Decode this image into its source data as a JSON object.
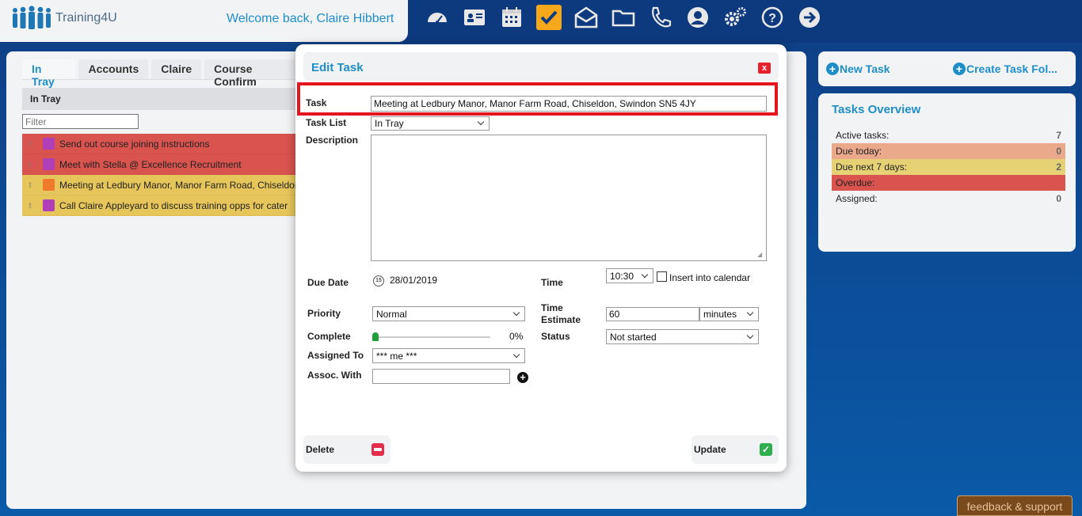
{
  "app": {
    "name": "Training4U",
    "welcome": "Welcome back, Claire Hibbert"
  },
  "nav": {
    "icons": [
      "dashboard-icon",
      "contacts-icon",
      "calendar-icon",
      "tasks-icon",
      "mail-icon",
      "folder-icon",
      "phone-icon",
      "user-icon",
      "settings-icon",
      "help-icon",
      "logout-icon"
    ],
    "active": "tasks-icon",
    "accent": "#f6a81b"
  },
  "tabs": [
    {
      "label": "In Tray"
    },
    {
      "label": "Accounts"
    },
    {
      "label": "Claire"
    },
    {
      "label": "Course Confirm"
    }
  ],
  "list": {
    "header": "In Tray",
    "filter_placeholder": "Filter",
    "tasks": [
      {
        "title": "Send out course joining instructions",
        "row_color": "#d9534f",
        "flag_color": "#b03fb8"
      },
      {
        "title": "Meet with Stella @ Excellence Recruitment",
        "row_color": "#d9534f",
        "flag_color": "#b03fb8"
      },
      {
        "title": "Meeting at Ledbury Manor, Manor Farm Road, Chiseldon",
        "row_color": "#e6c55a",
        "flag_color": "#f07b2a"
      },
      {
        "title": "Call Claire Appleyard to discuss training opps for cater",
        "row_color": "#e6c55a",
        "flag_color": "#b03fb8"
      }
    ]
  },
  "actions": {
    "new_task": "New Task",
    "create_folder": "Create Task Fol..."
  },
  "overview": {
    "title": "Tasks Overview",
    "rows": [
      {
        "label": "Active tasks:",
        "value": "7",
        "color": ""
      },
      {
        "label": "Due today:",
        "value": "0",
        "color": "#eaa98a"
      },
      {
        "label": "Due next 7 days:",
        "value": "2",
        "color": "#e6d274"
      },
      {
        "label": "Overdue:",
        "value": "",
        "color": "#d9534f"
      },
      {
        "label": "Assigned:",
        "value": "0",
        "color": ""
      }
    ]
  },
  "feedback": "feedback & support",
  "modal": {
    "title": "Edit Task",
    "close": "x",
    "labels": {
      "task": "Task",
      "task_list": "Task List",
      "description": "Description",
      "due_date": "Due Date",
      "time": "Time",
      "priority": "Priority",
      "time_estimate": "Time Estimate",
      "complete": "Complete",
      "status": "Status",
      "assigned_to": "Assigned To",
      "assoc_with": "Assoc. With",
      "insert_calendar": "Insert into calendar"
    },
    "values": {
      "task": "Meeting at Ledbury Manor, Manor Farm Road, Chiseldon, Swindon SN5 4JY",
      "task_list": "In Tray",
      "description": "",
      "due_date": "28/01/2019",
      "time": "10:30",
      "priority": "Normal",
      "time_estimate": "60",
      "time_unit": "minutes",
      "complete_pct": "0%",
      "complete_fraction": 0,
      "status": "Not started",
      "assigned_to": "*** me ***",
      "assoc_with": ""
    },
    "buttons": {
      "delete": "Delete",
      "update": "Update"
    }
  }
}
